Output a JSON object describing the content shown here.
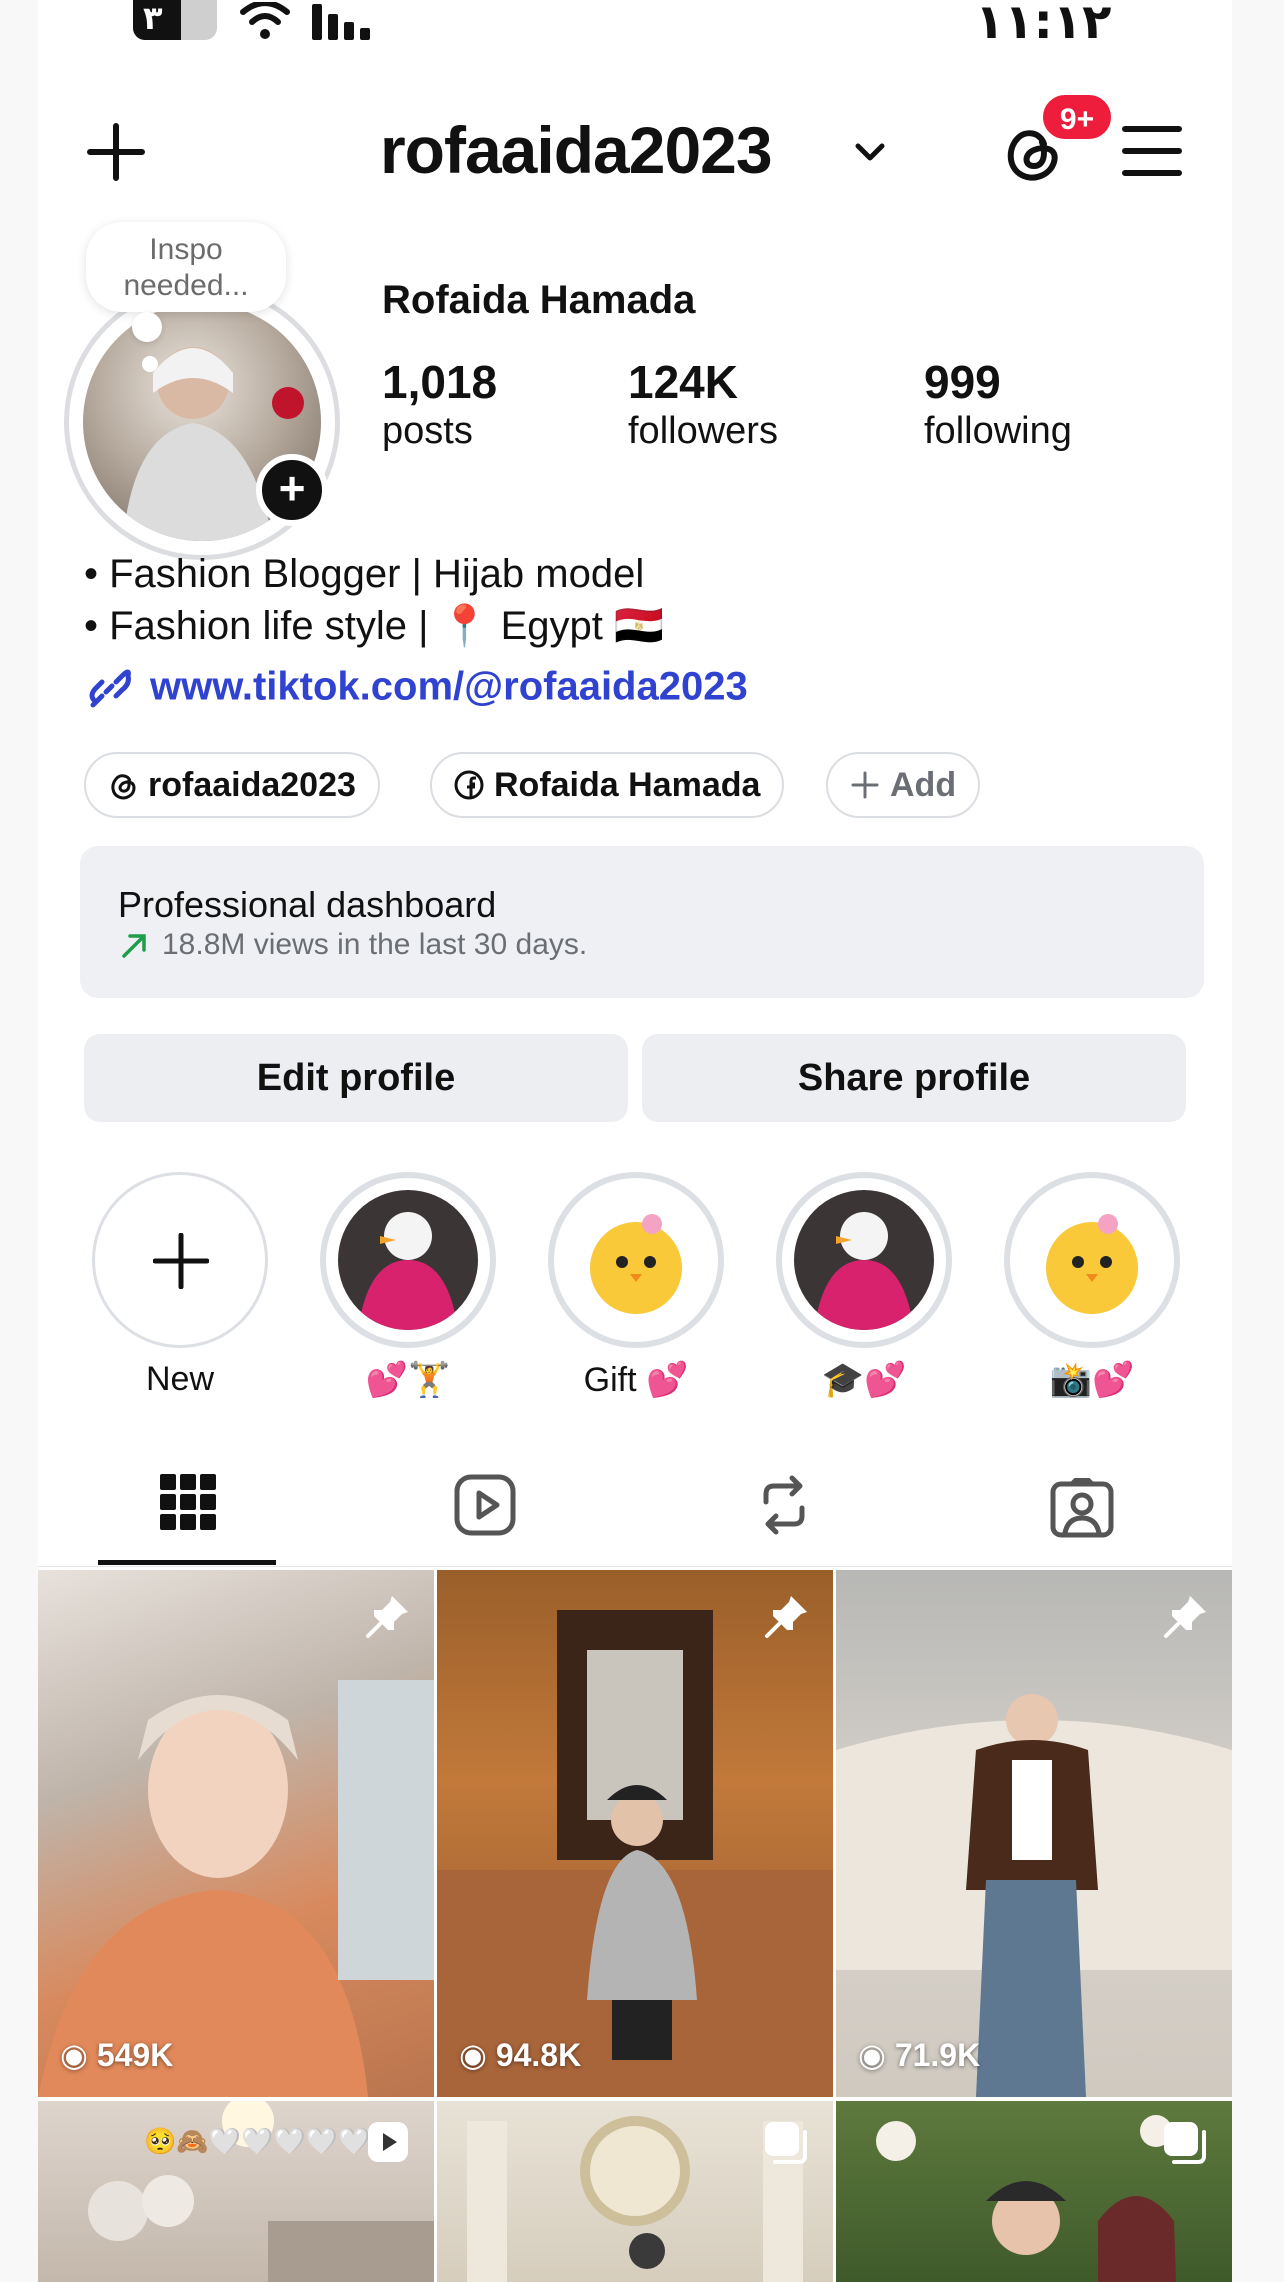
{
  "status_bar": {
    "battery_level": "٣",
    "time": "١١:١٢"
  },
  "header": {
    "username": "rofaaida2023",
    "threads_badge": "9+"
  },
  "note": {
    "text_line1": "Inspo",
    "text_line2": "needed..."
  },
  "profile": {
    "display_name": "Rofaida Hamada",
    "stats": [
      {
        "value": "1,018",
        "label": "posts"
      },
      {
        "value": "124K",
        "label": "followers"
      },
      {
        "value": "999",
        "label": "following"
      }
    ],
    "bio_line1": "• Fashion Blogger | Hijab model",
    "bio_line2": "• Fashion life style | 📍 Egypt 🇪🇬",
    "link": "www.tiktok.com/@rofaaida2023"
  },
  "chips": [
    {
      "icon": "threads-icon",
      "label": "rofaaida2023"
    },
    {
      "icon": "facebook-icon",
      "label": "Rofaida Hamada"
    },
    {
      "icon": "plus-icon",
      "label": "Add"
    }
  ],
  "dashboard": {
    "title": "Professional dashboard",
    "subtitle": "18.8M views in the last 30 days."
  },
  "actions": {
    "edit_label": "Edit profile",
    "share_label": "Share profile"
  },
  "highlights": [
    {
      "label": "New"
    },
    {
      "label": "💕🏋️"
    },
    {
      "label": "Gift 💕"
    },
    {
      "label": "🎓💕"
    },
    {
      "label": "📸💕"
    }
  ],
  "posts": [
    {
      "views": "549K",
      "pinned": true
    },
    {
      "views": "94.8K",
      "pinned": true
    },
    {
      "views": "71.9K",
      "pinned": true
    },
    {
      "caption": "🥺🙈🤍🤍🤍🤍🤍",
      "type": "reel"
    },
    {
      "type": "carousel"
    },
    {
      "type": "carousel"
    }
  ],
  "colors": {
    "link": "#3043d0",
    "badge": "#ee1d3c",
    "trend": "#1e9e4a"
  }
}
